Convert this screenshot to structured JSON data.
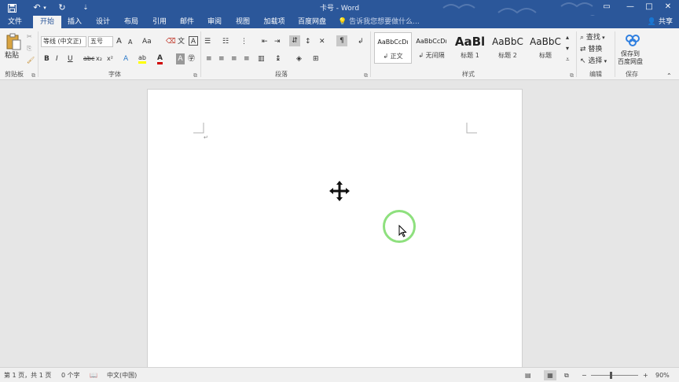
{
  "titlebar": {
    "title": "卡号 - Word",
    "save_icon": "save-icon",
    "undo_icon": "undo-icon",
    "redo_icon": "redo-icon",
    "customize_icon": "customize-qat-icon",
    "restore_label": "▭",
    "minimize_label": "—",
    "maximize_label": "□",
    "close_label": "✕"
  },
  "tabs": [
    "文件",
    "开始",
    "插入",
    "设计",
    "布局",
    "引用",
    "邮件",
    "审阅",
    "视图",
    "加载项",
    "百度网盘"
  ],
  "active_tab": "开始",
  "tell_me": "告诉我您想要做什么...",
  "share": "共享",
  "ribbon": {
    "clipboard": {
      "paste": "粘贴",
      "label": "剪贴板"
    },
    "font": {
      "font_name": "等线 (中文正)",
      "font_size": "五号",
      "grow": "A",
      "shrink": "A",
      "case": "Aa",
      "bold": "B",
      "italic": "I",
      "underline": "U",
      "strike": "abc",
      "subscript": "x₂",
      "superscript": "x²",
      "font_color": "A",
      "label": "字体"
    },
    "paragraph": {
      "label": "段落"
    },
    "styles": {
      "items": [
        {
          "sample": "AaBbCcDı",
          "name": "↲ 正文"
        },
        {
          "sample": "AaBbCcDı",
          "name": "↲ 无间隔"
        },
        {
          "sample": "AaBl",
          "name": "标题 1"
        },
        {
          "sample": "AaBbC",
          "name": "标题 2"
        },
        {
          "sample": "AaBbC",
          "name": "标题"
        }
      ],
      "label": "样式"
    },
    "editing": {
      "find": "查找",
      "replace": "替换",
      "select": "选择",
      "label": "编辑"
    },
    "save": {
      "button_line1": "保存到",
      "button_line2": "百度网盘",
      "label": "保存"
    }
  },
  "document": {
    "paragraph_mark": "↵"
  },
  "statusbar": {
    "page": "第 1 页，共 1 页",
    "words": "0 个字",
    "language": "中文(中国)",
    "zoom_minus": "−",
    "zoom_plus": "+",
    "zoom": "90%"
  },
  "colors": {
    "titlebar": "#2b579a",
    "ribbon_bg": "#f3f3f3",
    "click_ring": "#8ee07e",
    "highlight_yellow": "#ffff00",
    "font_red": "#d00000"
  }
}
